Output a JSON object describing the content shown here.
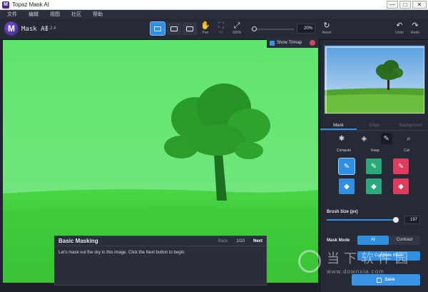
{
  "window": {
    "title": "Topaz Mask AI",
    "app_icon_letter": "M",
    "controls": {
      "minimize": "—",
      "maximize": "□",
      "close": "✕"
    }
  },
  "menu": [
    "文件",
    "编辑",
    "视图",
    "社区",
    "帮助"
  ],
  "toolbar": {
    "logo_letter": "M",
    "app_name": "Mask AI",
    "version": "v1.2.4",
    "pan_label": "Pan",
    "fit_label": "Fit",
    "zoom100_label": "100%",
    "zoom_value": "20%",
    "reset_label": "Reset",
    "undo_label": "Undo",
    "redo_label": "Redo"
  },
  "trimap": {
    "label": "Show Trimap"
  },
  "tutorial": {
    "title": "Basic Masking",
    "back": "Back",
    "page": "1/10",
    "next": "Next",
    "body": "Let's mask out the sky in this image. Click the Next button to begin."
  },
  "panel": {
    "tabs": [
      "Mask",
      "Edge",
      "Background"
    ],
    "brush_labels": [
      "Compute",
      "Keep",
      "Cut"
    ],
    "brush_size_label": "Brush Size (px)",
    "brush_size_value": "197",
    "brush_size_fraction": 0.97,
    "mask_mode_label": "Mask Mode",
    "mask_mode_ai": "AI",
    "mask_mode_contrast": "Contrast",
    "compute_mask": "Compute Mask",
    "save": "Save"
  },
  "watermark": {
    "text": "当下软件园",
    "url": "www.downxia.com"
  },
  "colors": {
    "accent": "#2f8fe0",
    "keep": "#2aa97a",
    "cut": "#e03a5c",
    "overlay": "#33e64a"
  },
  "icons": {
    "pan": "hand-icon",
    "fit": "fit-icon",
    "zoom100": "expand-icon",
    "reset": "reset-icon",
    "undo": "undo-icon",
    "redo": "redo-icon"
  }
}
